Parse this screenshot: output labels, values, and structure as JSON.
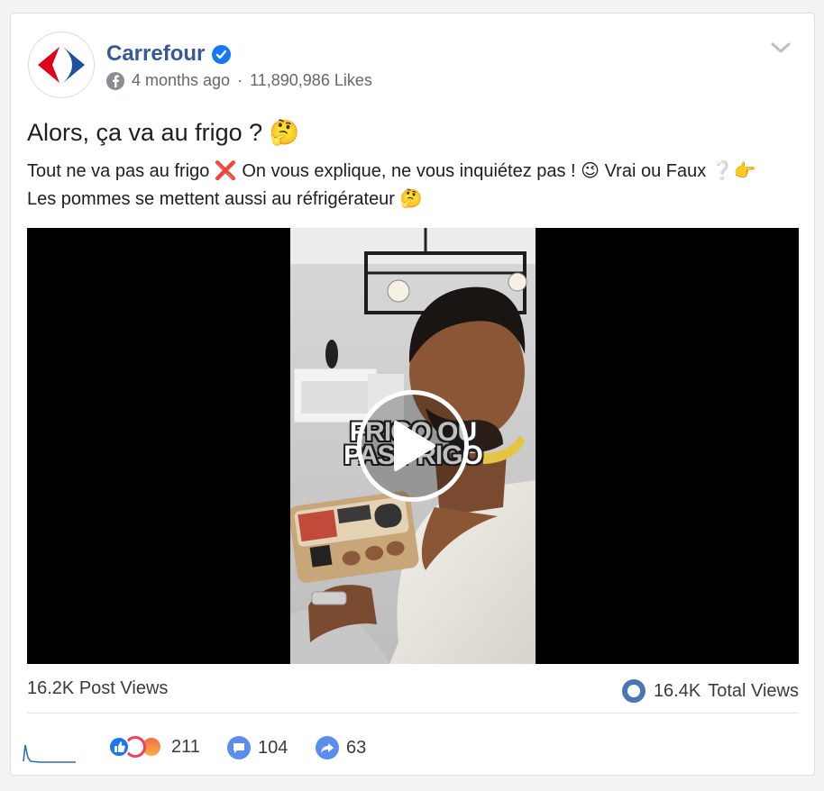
{
  "post": {
    "page_name": "Carrefour",
    "time": "4 months ago",
    "separator": "·",
    "likes": "11,890,986 Likes",
    "title": "Alors, ça va au frigo ? 🤔",
    "text": "Tout ne va pas au frigo ❌ On vous explique, ne vous inquiétez pas ! 😉 Vrai ou Faux ❔👉 Les pommes se mettent aussi au réfrigérateur 🤔"
  },
  "video": {
    "caption_line1": "FRIGO OU",
    "caption_line2": "PAS FRIGO"
  },
  "stats": {
    "post_views": "16.2K Post Views",
    "total_views_value": "16.4K",
    "total_views_label": "Total Views"
  },
  "engagement": {
    "reactions": "211",
    "comments": "104",
    "shares": "63"
  },
  "colors": {
    "brand_blue": "#385898",
    "accent": "#1877f2",
    "like": "#1877f2",
    "love": "#f33e58",
    "angry": "#e9710f"
  }
}
